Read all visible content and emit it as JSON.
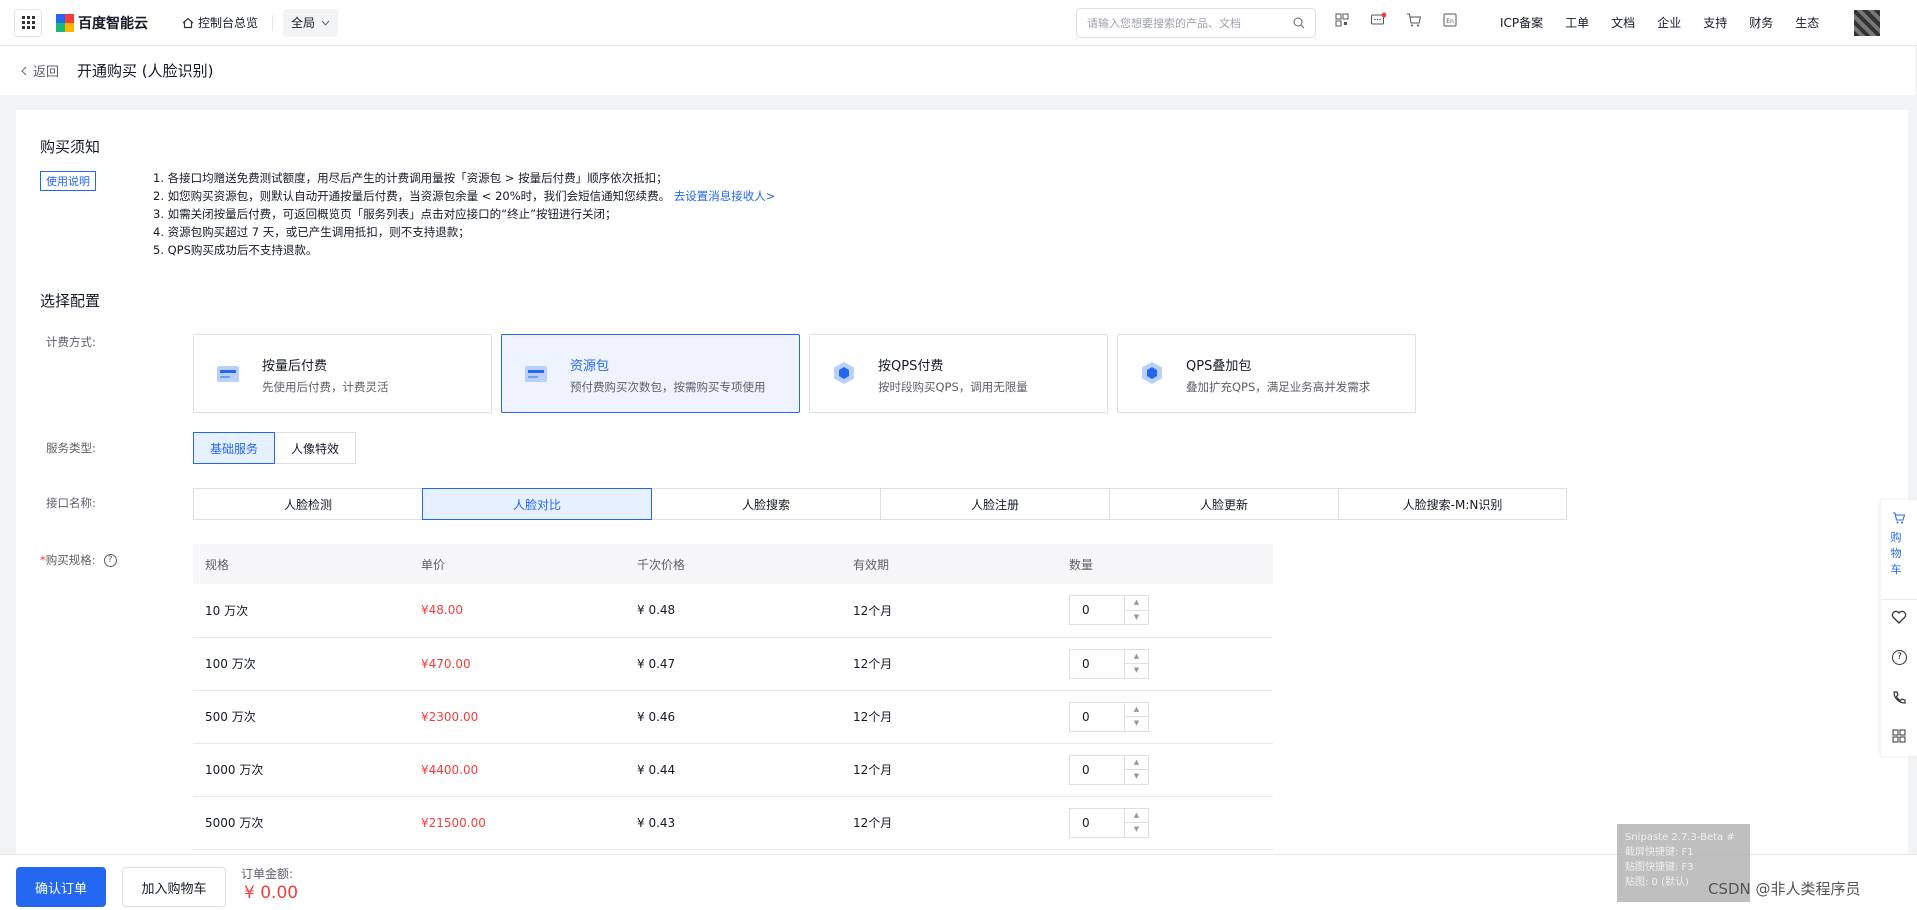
{
  "topnav": {
    "logo_text": "百度智能云",
    "console_label": "控制台总览",
    "region": "全局",
    "search_placeholder": "请输入您想要搜索的产品、文档",
    "links": [
      "ICP备案",
      "工单",
      "文档",
      "企业",
      "支持",
      "财务",
      "生态"
    ]
  },
  "pagebar": {
    "back_label": "返回",
    "title": "开通购买 (人脸识别)"
  },
  "notice": {
    "title": "购买须知",
    "tag": "使用说明",
    "lines": [
      "1. 各接口均赠送免费测试额度，用尽后产生的计费调用量按「资源包 > 按量后付费」顺序依次抵扣；",
      "2. 如您购买资源包，则默认自动开通按量后付费，当资源包余量 < 20%时，我们会短信通知您续费。",
      "3. 如需关闭按量后付费，可返回概览页「服务列表」点击对应接口的“终止”按钮进行关闭；",
      "4. 资源包购买超过 7 天，或已产生调用抵扣，则不支持退款；",
      "5. QPS购买成功后不支持退款。"
    ],
    "link": "去设置消息接收人>"
  },
  "config": {
    "title": "选择配置",
    "billing_label": "计费方式:",
    "billing_options": [
      {
        "title": "按量后付费",
        "desc": "先使用后付费，计费灵活"
      },
      {
        "title": "资源包",
        "desc": "预付费购买次数包，按需购买专项使用"
      },
      {
        "title": "按QPS付费",
        "desc": "按时段购买QPS，调用无限量"
      },
      {
        "title": "QPS叠加包",
        "desc": "叠加扩充QPS，满足业务高并发需求"
      }
    ],
    "selected_billing": 1,
    "service_label": "服务类型:",
    "service_options": [
      "基础服务",
      "人像特效"
    ],
    "api_label": "接口名称:",
    "api_options": [
      "人脸检测",
      "人脸对比",
      "人脸搜索",
      "人脸注册",
      "人脸更新",
      "人脸搜索-M:N识别"
    ],
    "spec_label": "购买规格:"
  },
  "table": {
    "headers": [
      "规格",
      "单价",
      "千次价格",
      "有效期",
      "数量"
    ],
    "rows": [
      {
        "spec": "10 万次",
        "price": "¥48.00",
        "per_k": "¥ 0.48",
        "validity": "12个月",
        "qty": "0"
      },
      {
        "spec": "100 万次",
        "price": "¥470.00",
        "per_k": "¥ 0.47",
        "validity": "12个月",
        "qty": "0"
      },
      {
        "spec": "500 万次",
        "price": "¥2300.00",
        "per_k": "¥ 0.46",
        "validity": "12个月",
        "qty": "0"
      },
      {
        "spec": "1000 万次",
        "price": "¥4400.00",
        "per_k": "¥ 0.44",
        "validity": "12个月",
        "qty": "0"
      },
      {
        "spec": "5000 万次",
        "price": "¥21500.00",
        "per_k": "¥ 0.43",
        "validity": "12个月",
        "qty": "0"
      }
    ]
  },
  "float": {
    "cart": "购物车"
  },
  "bottom": {
    "confirm": "确认订单",
    "add_cart": "加入购物车",
    "total_label": "订单金额:",
    "total_value": "¥ 0.00"
  },
  "overlay": {
    "snipaste": [
      "Snipaste 2.7.3-Beta #",
      "截屏快捷键: F1",
      "贴图快捷键: F3",
      "贴图: 0 (默认)"
    ],
    "watermark": "CSDN @非人类程序员"
  }
}
